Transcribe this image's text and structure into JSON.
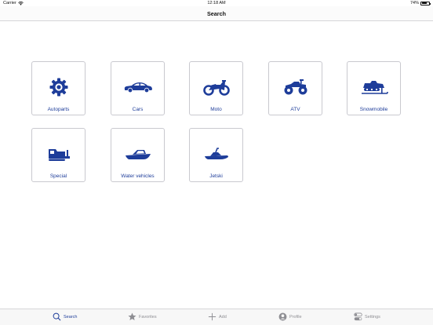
{
  "status_bar": {
    "carrier": "Carrier",
    "time": "12:18 AM",
    "battery": "74%",
    "battery_level": 0.74
  },
  "nav": {
    "title": "Search"
  },
  "colors": {
    "accent": "#1e3d9a",
    "inactive": "#8e8e93",
    "tile_border": "#c9c9cf"
  },
  "categories": [
    {
      "label": "Autoparts",
      "icon": "gear-icon"
    },
    {
      "label": "Cars",
      "icon": "car-icon"
    },
    {
      "label": "Moto",
      "icon": "motorcycle-icon"
    },
    {
      "label": "ATV",
      "icon": "atv-icon"
    },
    {
      "label": "Snowmobile",
      "icon": "snowmobile-icon"
    },
    {
      "label": "Special",
      "icon": "special-vehicle-icon"
    },
    {
      "label": "Water vehicles",
      "icon": "boat-icon"
    },
    {
      "label": "Jetski",
      "icon": "jetski-icon"
    }
  ],
  "tabs": [
    {
      "label": "Search",
      "icon": "search-icon",
      "active": true
    },
    {
      "label": "Favorites",
      "icon": "star-icon",
      "active": false
    },
    {
      "label": "Add",
      "icon": "plus-icon",
      "active": false
    },
    {
      "label": "Profile",
      "icon": "profile-icon",
      "active": false
    },
    {
      "label": "Settings",
      "icon": "settings-toggle-icon",
      "active": false
    }
  ]
}
